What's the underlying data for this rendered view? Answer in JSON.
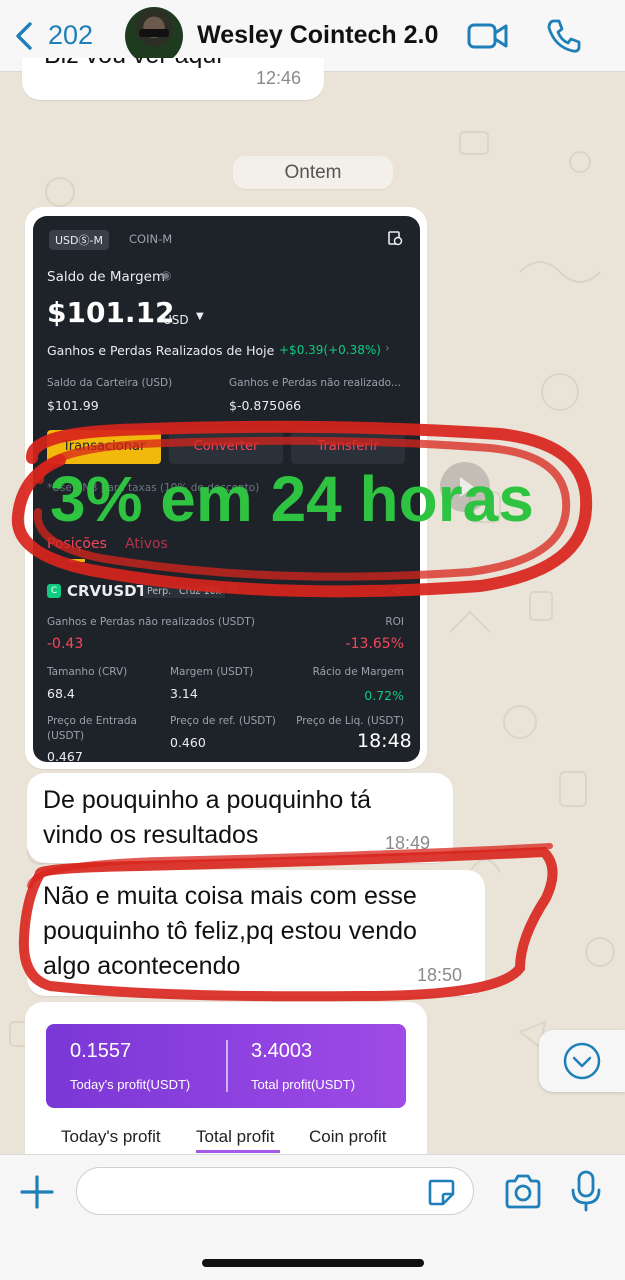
{
  "header": {
    "back_count": "202",
    "contact_name": "Wesley Cointech 2.0"
  },
  "messages": {
    "top_partial_text": "Biz vou ver aqui",
    "top_partial_time": "12:46",
    "date_divider": "Ontem",
    "image_time": "18:48",
    "msg1_line1": "De pouquinho a pouquinho tá",
    "msg1_line2": "vindo os resultados",
    "msg1_time": "18:49",
    "msg2_line1": "Não e muita coisa mais com esse",
    "msg2_line2": "pouquinho tô feliz,pq estou vendo",
    "msg2_line3": "algo acontecendo",
    "msg2_time": "18:50"
  },
  "exchange_screenshot": {
    "tab_usds": "USDⓈ-M",
    "tab_coin": "COIN-M",
    "margin_label": "Saldo de Margem",
    "margin_value": "$101.12",
    "margin_currency": "USD",
    "realized_label": "Ganhos e Perdas Realizados de Hoje",
    "realized_value": "+$0.39(+0.38%)",
    "wallet_label": "Saldo da Carteira (USD)",
    "wallet_value": "$101.99",
    "unrealized_label": "Ganhos e Perdas não realizado...",
    "unrealized_value": "$-0.875066",
    "btn_trade": "Transacionar",
    "btn_convert": "Converter",
    "btn_transfer": "Transferir",
    "fee_note_partial": "*Use BNB para taxas (10% de desconto)",
    "tab_positions": "Posições",
    "tab_assets": "Ativos",
    "symbol": "CRVUSDT",
    "perp_tag": "Perp.",
    "cross_tag": "Cruz 10x",
    "pnl_label": "Ganhos e Perdas não realizados (USDT)",
    "pnl_value": "-0.43",
    "roi_label": "ROI",
    "roi_value": "-13.65%",
    "size_label": "Tamanho (CRV)",
    "size_value": "68.4",
    "margin_usdt_label": "Margem (USDT)",
    "margin_usdt_value": "3.14",
    "margin_ratio_label": "Rácio de Margem",
    "margin_ratio_value": "0.72%",
    "entry_label_1": "Preço de Entrada",
    "entry_label_2": "(USDT)",
    "entry_value": "0.467",
    "ref_label": "Preço de ref. (USDT)",
    "ref_value": "0.460",
    "liq_label": "Preço de Liq. (USDT)"
  },
  "overlay": {
    "text": "3% em 24 horas",
    "color": "#2fc342",
    "scribble_color": "#d8241c"
  },
  "profit_card": {
    "today_value": "0.1557",
    "today_label": "Today's profit(USDT)",
    "total_value": "3.4003",
    "total_label": "Total profit(USDT)",
    "tab_today": "Today's profit",
    "tab_total": "Total profit",
    "tab_coin": "Coin profit"
  },
  "colors": {
    "accent_blue": "#1f7fb9",
    "binance_yellow": "#f0b90b",
    "red": "#f6465d",
    "green": "#0ecb81"
  }
}
